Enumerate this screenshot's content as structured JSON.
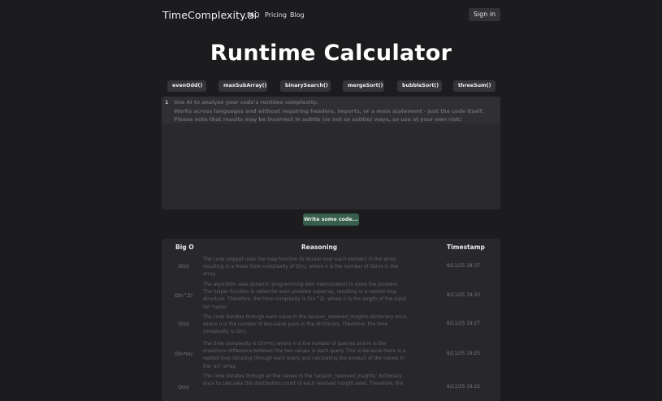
{
  "nav": {
    "brand": "TimeComplexity.ai",
    "links": [
      "FAQ",
      "Pricing",
      "Blog"
    ],
    "signin": "Sign in"
  },
  "title": "Runtime Calculator",
  "examples": [
    "evenOdd()",
    "maxSubArray()",
    "binarySearch()",
    "mergeSort()",
    "bubbleSort()",
    "threeSum()"
  ],
  "editor": {
    "line_number": "1",
    "placeholder_lines": [
      "Use AI to analyze your code's runtime complexity.",
      "Works across languages and without requiring headers, imports, or a main statement - just the code itself.",
      "Please note that results may be incorrect in subtle (or not so subtle) ways, so use at your own risk!"
    ]
  },
  "write_button": "Write some code...",
  "table": {
    "headers": [
      "Big O",
      "Reasoning",
      "Timestamp"
    ],
    "rows": [
      {
        "bigo": "O(n)",
        "reasoning": [
          "The code snippet uses the map function to iterate over each element in the array,",
          "resulting in a linear time complexity of O(n), where n is the number of items in the",
          "array."
        ],
        "timestamp": "8/11/25 19:37"
      },
      {
        "bigo": "O(n^2)",
        "reasoning": [
          "The algorithm uses dynamic programming with memoization to solve the problem.",
          "The helper function is called for each possible subarray, resulting in a nested loop",
          "structure. Therefore, the time complexity is O(n^2), where n is the length of the input",
          "list 'nums'."
        ],
        "timestamp": "8/11/25 19:33"
      },
      {
        "bigo": "O(n)",
        "reasoning": [
          "The code iterates through each value in the session_resolved_insights dictionary once,",
          "where n is the number of key-value pairs in the dictionary. Therefore, the time",
          "complexity is O(n)."
        ],
        "timestamp": "8/11/25 19:27"
      },
      {
        "bigo": "O(n*m)",
        "reasoning": [
          "The time complexity is O(n*m) where n is the number of queries and m is the",
          "maximum difference between the two values in each query. This is because there is a",
          "nested loop iterating through each query and calculating the product of the values in",
          "the 'arr' array."
        ],
        "timestamp": "8/11/25 19:25"
      },
      {
        "bigo": "O(n)",
        "reasoning": [
          "The code iterates through all the values in the 'session_resolved_insights' dictionary",
          "once to calculate the distribution count of each resolved insight label. Therefore, the"
        ],
        "timestamp": "8/11/25 19:22"
      }
    ]
  }
}
